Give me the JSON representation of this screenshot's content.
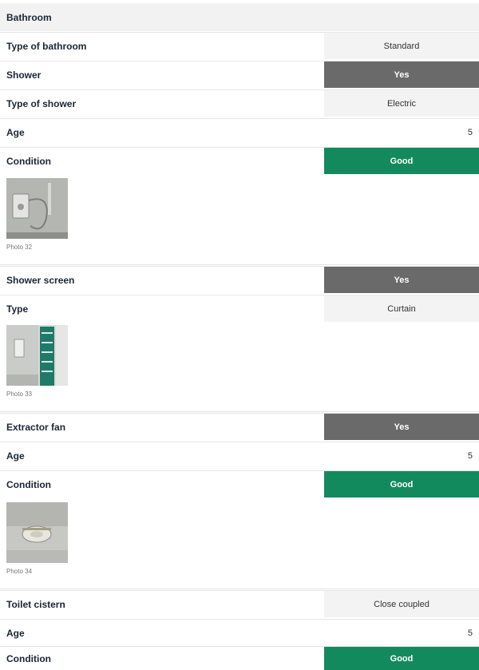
{
  "section": {
    "title": "Bathroom"
  },
  "rows": [
    {
      "label": "Type of bathroom",
      "value": "Standard"
    },
    {
      "label": "Shower",
      "value": "Yes"
    },
    {
      "label": "Type of shower",
      "value": "Electric"
    },
    {
      "label": "Age",
      "value": "5"
    },
    {
      "label": "Condition",
      "value": "Good"
    },
    {
      "label": "Shower screen",
      "value": "Yes"
    },
    {
      "label": "Type",
      "value": "Curtain"
    },
    {
      "label": "Extractor fan",
      "value": "Yes"
    },
    {
      "label": "Age",
      "value": "5"
    },
    {
      "label": "Condition",
      "value": "Good"
    },
    {
      "label": "Toilet cistern",
      "value": "Close coupled"
    },
    {
      "label": "Age",
      "value": "5"
    },
    {
      "label": "Condition",
      "value": "Good"
    }
  ],
  "photos": [
    {
      "caption": "Photo 32",
      "icon": "electric-shower-photo"
    },
    {
      "caption": "Photo 33",
      "icon": "shower-curtain-photo"
    },
    {
      "caption": "Photo 34",
      "icon": "extractor-fan-photo"
    }
  ],
  "colors": {
    "yes_fill": "#6a6a6a",
    "good_fill": "#138a5e",
    "light_fill": "#f3f3f3"
  }
}
